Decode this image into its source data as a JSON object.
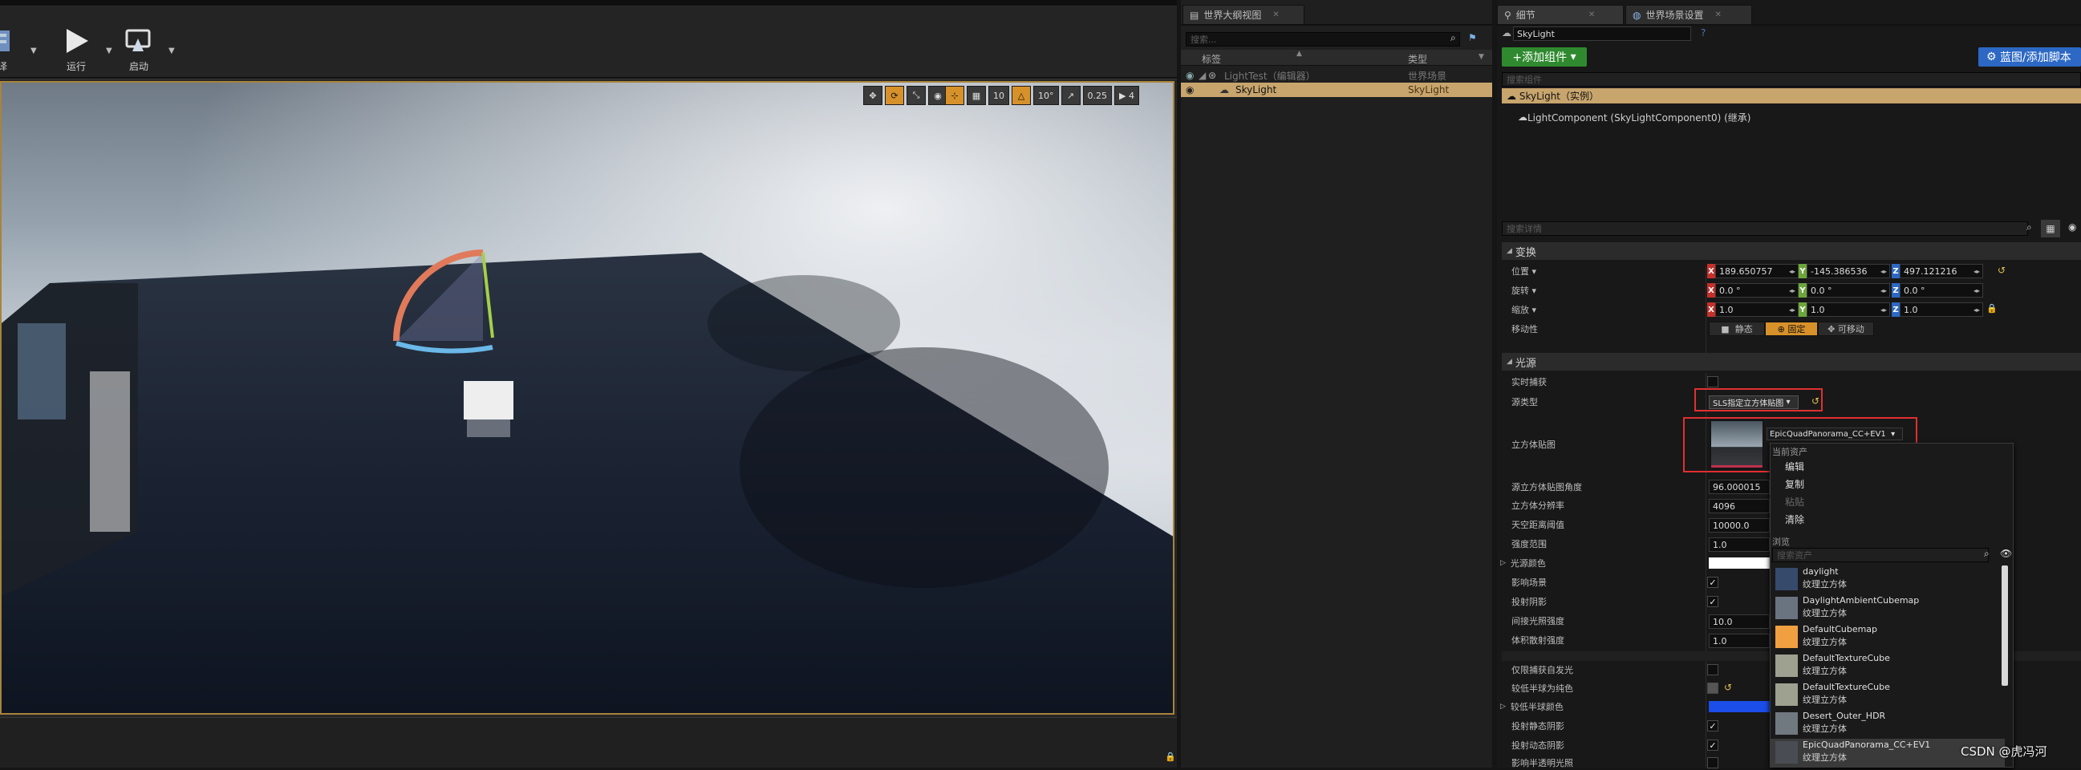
{
  "toolbar": {
    "build_label": "译",
    "run_label": "运行",
    "launch_label": "启动"
  },
  "viewport_tools": {
    "grid_snap": "10",
    "rotate_snap": "10°",
    "scale_snap": "0.25",
    "camera_speed": "4"
  },
  "outliner": {
    "tab": "世界大纲视图",
    "search_placeholder": "搜索...",
    "col_label": "标签",
    "col_type": "类型",
    "rows": [
      {
        "label": "LightTest（编辑器）",
        "type": "世界场景"
      },
      {
        "label": "SkyLight",
        "type": "SkyLight"
      }
    ]
  },
  "details": {
    "tab_details": "细节",
    "tab_world": "世界场景设置",
    "actor_name": "SkyLight",
    "add_component": "+添加组件",
    "blueprint_btn": "蓝图/添加脚本",
    "search_components": "搜索组件",
    "instance_label": "SkyLight（实例）",
    "component_label": "LightComponent (SkyLightComponent0) (继承)",
    "search_details": "搜索详情",
    "transform": {
      "category": "变换",
      "location_label": "位置",
      "location": [
        "189.650757",
        "-145.386536",
        "497.121216"
      ],
      "rotation_label": "旋转",
      "rotation": [
        "0.0 °",
        "0.0 °",
        "0.0 °"
      ],
      "scale_label": "缩放",
      "scale": [
        "1.0",
        "1.0",
        "1.0"
      ],
      "mobility_label": "移动性",
      "mobility": [
        "静态",
        "固定",
        "可移动"
      ]
    },
    "light": {
      "category": "光源",
      "realtime_capture": "实时捕获",
      "source_type_label": "源类型",
      "source_type": "SLS指定立方体贴图",
      "cubemap_label": "立方体贴图",
      "cubemap_value": "EpicQuadPanorama_CC+EV1",
      "angle_label": "源立方体贴图角度",
      "angle_value": "96.000015",
      "resolution_label": "立方体分辨率",
      "resolution_value": "4096",
      "sky_distance_label": "天空距离阈值",
      "sky_distance_value": "10000.0",
      "intensity_label": "强度范围",
      "intensity_value": "1.0",
      "light_color_label": "光源颜色",
      "affects_world_label": "影响场景",
      "cast_shadows_label": "投射阴影",
      "indirect_label": "间接光照强度",
      "indirect_value": "10.0",
      "volumetric_label": "体积散射强度",
      "volumetric_value": "1.0",
      "emissive_only_label": "仅限捕获自发光",
      "lower_hemisphere_solid_label": "较低半球为纯色",
      "lower_hemisphere_color_label": "较低半球颜色",
      "cast_static_label": "投射静态阴影",
      "cast_dynamic_label": "投射动态阴影",
      "translucent_label": "影响半透明光照"
    }
  },
  "dropdown": {
    "current_asset": "当前资产",
    "edit": "编辑",
    "copy": "复制",
    "paste": "粘贴",
    "clear": "清除",
    "browse": "浏览",
    "search_placeholder": "搜索资产",
    "assets": [
      {
        "name": "daylight",
        "type": "纹理立方体"
      },
      {
        "name": "DaylightAmbientCubemap",
        "type": "纹理立方体"
      },
      {
        "name": "DefaultCubemap",
        "type": "纹理立方体"
      },
      {
        "name": "DefaultTextureCube",
        "type": "纹理立方体"
      },
      {
        "name": "DefaultTextureCube",
        "type": "纹理立方体"
      },
      {
        "name": "Desert_Outer_HDR",
        "type": "纹理立方体"
      },
      {
        "name": "EpicQuadPanorama_CC+EV1",
        "type": "纹理立方体"
      }
    ]
  },
  "watermark": "CSDN @虎冯河",
  "colors": {
    "selection": "#d7912a",
    "highlight_row": "#c8a56d",
    "red_box": "#e03030",
    "accent_blue": "#2c68c4",
    "add_green": "#2f8a2f"
  }
}
